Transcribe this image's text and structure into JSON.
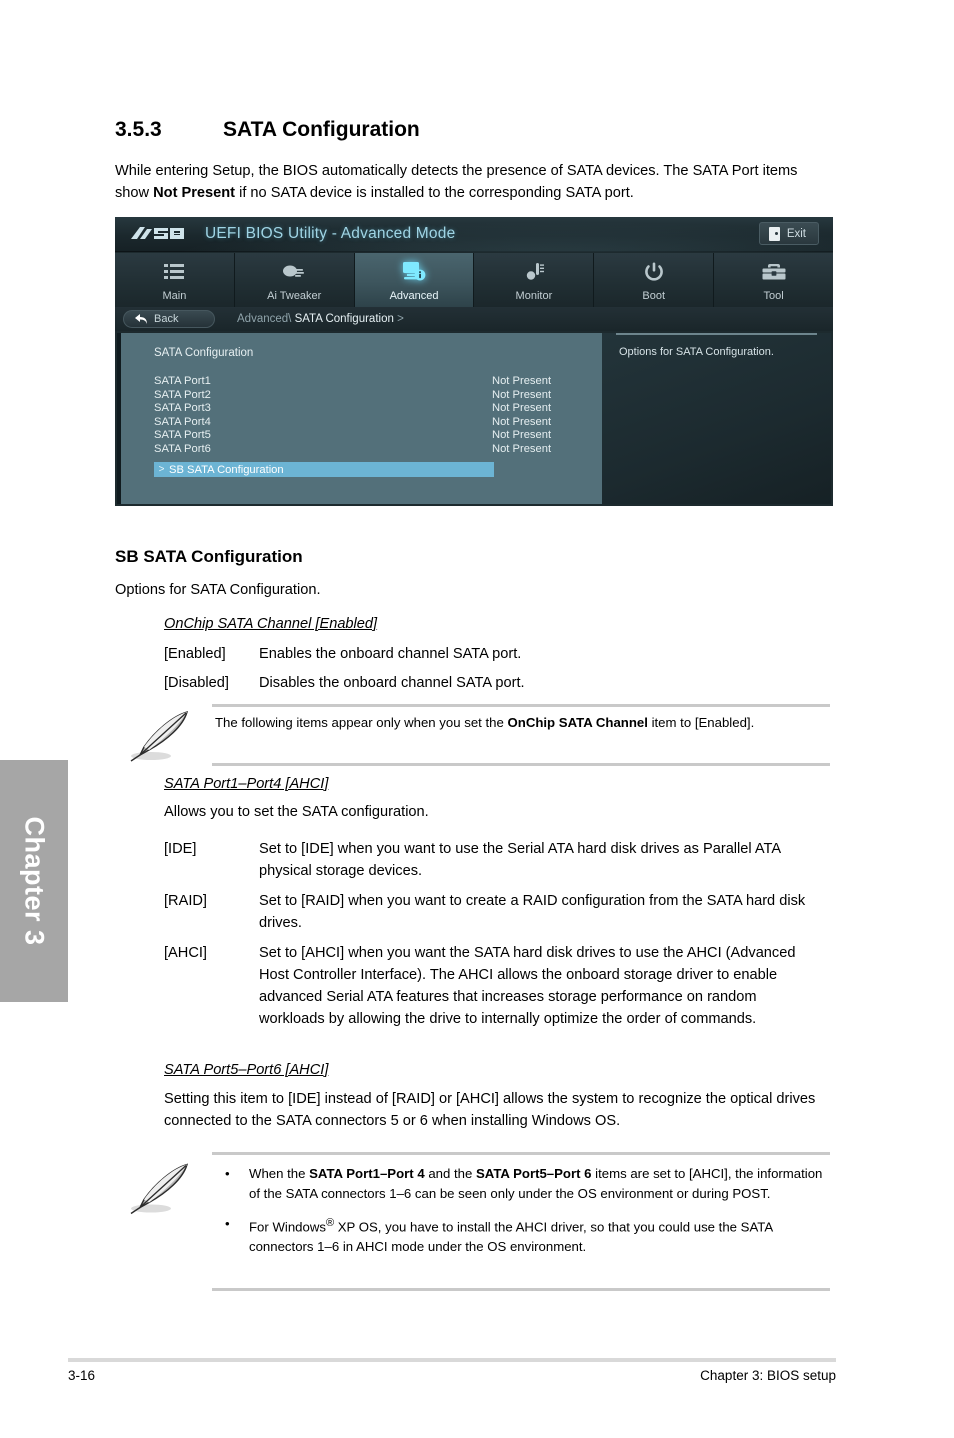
{
  "chapter_tab": {
    "label": "Chapter 3"
  },
  "heading": {
    "number": "3.5.3",
    "title": "SATA Configuration"
  },
  "intro": {
    "line1": "While entering Setup, the BIOS automatically detects the presence of SATA devices. The SATA",
    "line2_a": "Port items show ",
    "line2_bold": "Not Present",
    "line2_b": " if no SATA device is installed to the corresponding SATA port."
  },
  "bios": {
    "logo": "/ISUS",
    "title": "UEFI BIOS Utility - Advanced Mode",
    "exit_label": "Exit",
    "nav": [
      {
        "label": "Main",
        "icon": "list-icon",
        "active": false
      },
      {
        "label": "Ai Tweaker",
        "icon": "tweaker-icon",
        "active": false
      },
      {
        "label": "Advanced",
        "icon": "advanced-monitor-icon",
        "active": true
      },
      {
        "label": "Monitor",
        "icon": "thermometer-icon",
        "active": false
      },
      {
        "label": "Boot",
        "icon": "power-icon",
        "active": false
      },
      {
        "label": "Tool",
        "icon": "toolbox-icon",
        "active": false
      }
    ],
    "back_label": "Back",
    "breadcrumb_prefix": "Advanced\\",
    "breadcrumb_current": "SATA Configuration",
    "breadcrumb_suffix": ">",
    "section_title": "SATA Configuration",
    "ports": [
      {
        "name": "SATA Port1",
        "value": "Not Present"
      },
      {
        "name": "SATA Port2",
        "value": "Not Present"
      },
      {
        "name": "SATA Port3",
        "value": "Not Present"
      },
      {
        "name": "SATA Port4",
        "value": "Not Present"
      },
      {
        "name": "SATA Port5",
        "value": "Not Present"
      },
      {
        "name": "SATA Port6",
        "value": "Not Present"
      }
    ],
    "submenu": {
      "arrow": ">",
      "label": "SB SATA Configuration"
    },
    "help_text": "Options for SATA Configuration.",
    "colors": {
      "highlight": "#6cb4d4",
      "panel": "#53707a",
      "accent": "#9fd4e4"
    }
  },
  "sb_section": {
    "heading": "SB SATA Configuration",
    "description": "Options for SATA Configuration.",
    "onchip": {
      "title": "OnChip SATA Channel [Enabled]",
      "options": [
        {
          "term": "[Enabled]",
          "desc": "Enables the onboard channel SATA port."
        },
        {
          "term": "[Disabled]",
          "desc": "Disables the onboard channel SATA port."
        }
      ]
    },
    "note1": {
      "line1_a": "The following items appear only when you set the ",
      "line1_bold": "OnChip SATA Channel",
      "line1_b": " item to",
      "line2": "[Enabled]."
    },
    "port1_4": {
      "title": "SATA Port1–Port4 [AHCI]",
      "description": "Allows you to set the SATA configuration.",
      "options": [
        {
          "term": "[IDE]",
          "desc": "Set to [IDE] when you want to use the Serial ATA hard disk drives as Parallel ATA physical storage devices."
        },
        {
          "term": "[RAID]",
          "desc": "Set to [RAID] when you want to create a RAID configuration from the SATA hard disk drives."
        },
        {
          "term": "[AHCI]",
          "desc": "Set to [AHCI] when you want the SATA hard disk drives to use the AHCI (Advanced Host Controller Interface). The AHCI allows the onboard storage driver to enable advanced Serial ATA features that increases storage performance on random workloads by allowing the drive to internally optimize the order of commands."
        }
      ]
    },
    "port5_6": {
      "title": "SATA Port5–Port6 [AHCI]",
      "description": "Setting this item to [IDE] instead of [RAID] or [AHCI] allows the system to recognize the optical drives connected to the SATA connectors 5 or 6 when installing Windows OS."
    },
    "note2": {
      "bullets": [
        {
          "pre": "When the ",
          "bold1": "SATA Port1–Port 4",
          "mid": " and the ",
          "bold2": "SATA Port5–Port 6",
          "post": " items are set to [AHCI], the information of the SATA connectors 1–6 can be seen only under the OS environment or during POST."
        },
        {
          "pre": "For Windows",
          "sup": "®",
          "post": " XP OS, you have to install the AHCI driver, so that you could use the SATA connectors 1–6 in AHCI mode under the OS environment."
        }
      ]
    }
  },
  "footer": {
    "page_number": "3-16",
    "chapter_label": "Chapter 3: BIOS setup"
  }
}
